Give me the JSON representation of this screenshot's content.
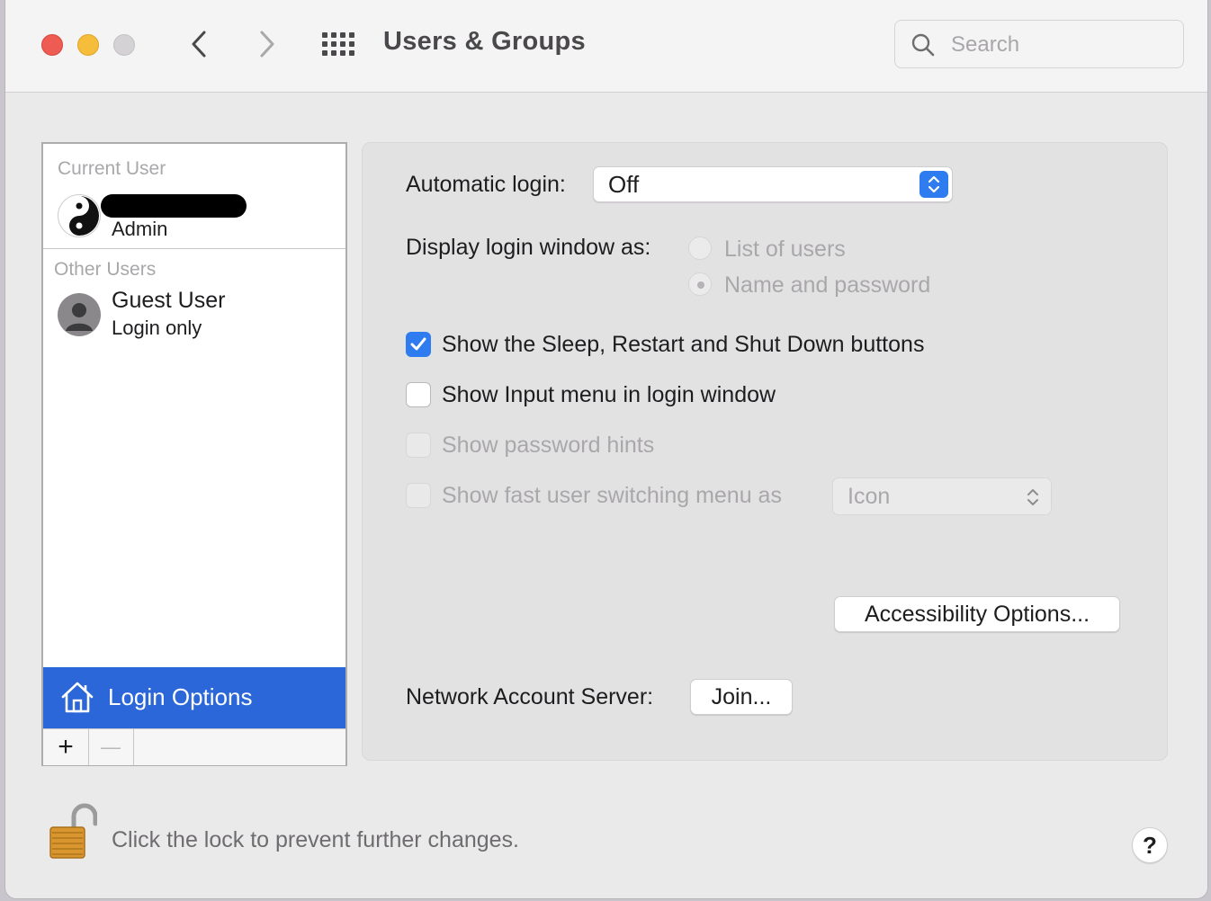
{
  "window": {
    "title": "Users & Groups",
    "search_placeholder": "Search"
  },
  "sidebar": {
    "current_user_label": "Current User",
    "current_user": {
      "name": "",
      "role": "Admin",
      "avatar": "yin-yang-icon"
    },
    "other_users_label": "Other Users",
    "other_users": [
      {
        "name": "Guest User",
        "role": "Login only",
        "avatar": "person-icon"
      }
    ],
    "login_options_label": "Login Options",
    "add_label": "+",
    "remove_label": "—"
  },
  "settings": {
    "automatic_login_label": "Automatic login:",
    "automatic_login_value": "Off",
    "display_login_label": "Display login window as:",
    "display_options": [
      {
        "label": "List of users",
        "selected": false
      },
      {
        "label": "Name and password",
        "selected": true
      }
    ],
    "checkboxes": [
      {
        "label": "Show the Sleep, Restart and Shut Down buttons",
        "checked": true,
        "enabled": true
      },
      {
        "label": "Show Input menu in login window",
        "checked": false,
        "enabled": true
      },
      {
        "label": "Show password hints",
        "checked": false,
        "enabled": false
      },
      {
        "label": "Show fast user switching menu as",
        "checked": false,
        "enabled": false
      }
    ],
    "fast_switch_value": "Icon",
    "accessibility_button": "Accessibility Options...",
    "network_label": "Network Account Server:",
    "join_button": "Join..."
  },
  "footer": {
    "lock_text": "Click the lock to prevent further changes.",
    "help_label": "?"
  },
  "colors": {
    "accent": "#2f7bf0",
    "selection": "#2b67d8"
  }
}
